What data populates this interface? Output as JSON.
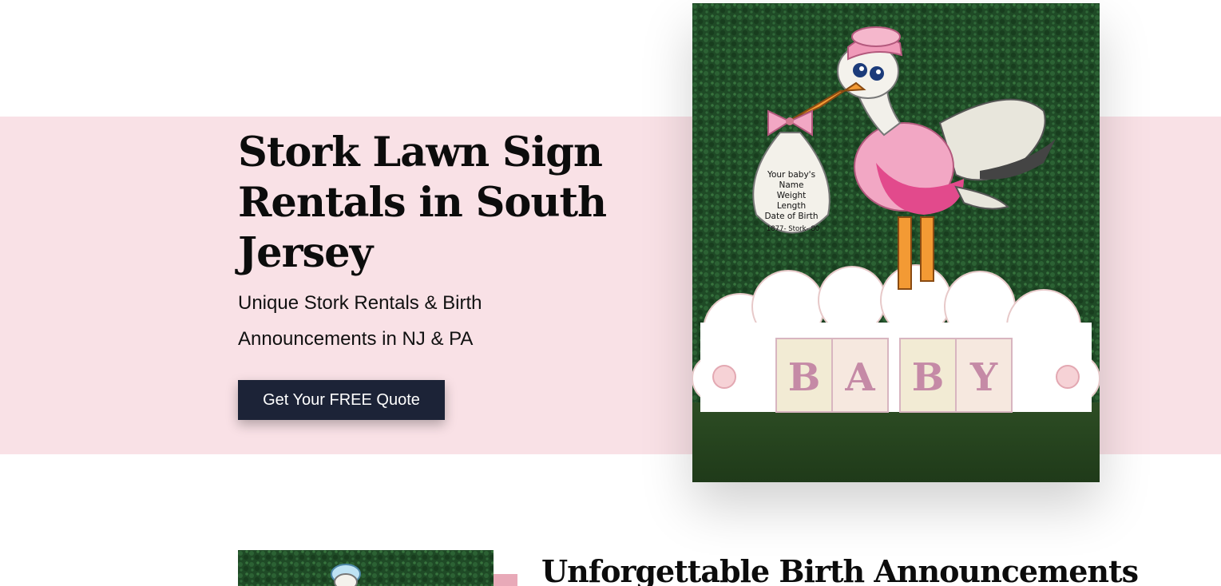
{
  "hero": {
    "title": "Stork Lawn Sign Rentals in South Jersey",
    "subtitle": "Unique Stork Rentals & Birth Announcements in NJ & PA",
    "cta_label": "Get Your FREE Quote"
  },
  "hero_image": {
    "bag_lines": [
      "Your baby's",
      "Name",
      "Weight",
      "Length",
      "Date of Birth",
      "1877- Stork- 80"
    ],
    "block_letters": [
      "B",
      "A",
      "B",
      "Y"
    ]
  },
  "section": {
    "heading": "Unforgettable Birth Announcements"
  },
  "colors": {
    "hero_band": "#f9e1e6",
    "button_bg": "#1c2337",
    "accent_pink": "#e8a9b8"
  }
}
